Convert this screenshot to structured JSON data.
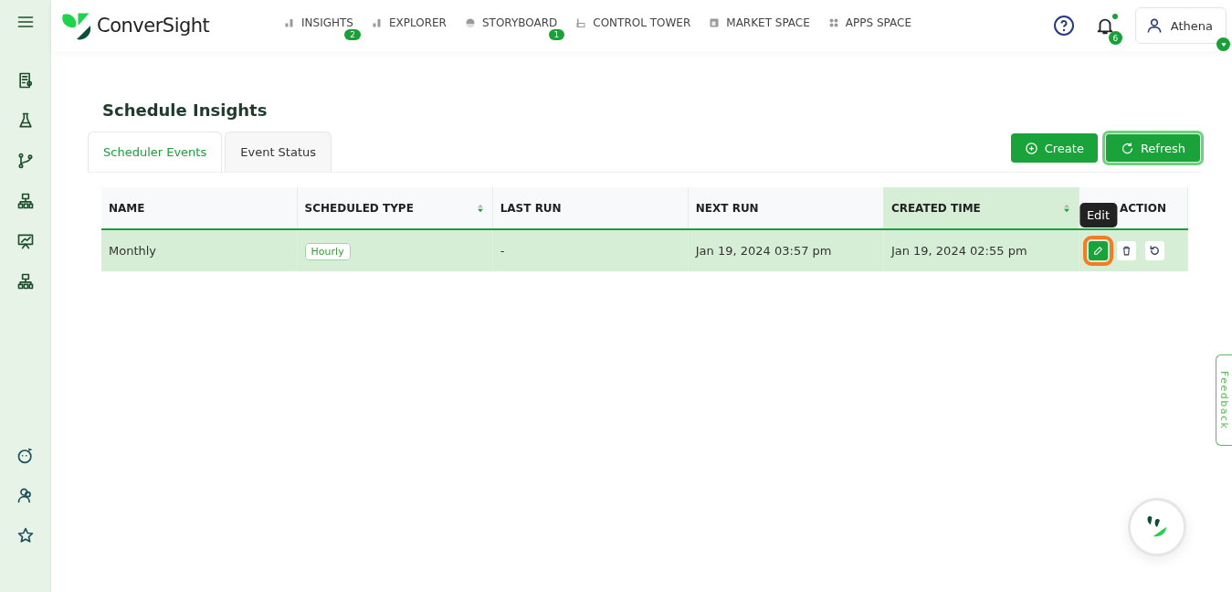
{
  "header": {
    "brand": "ConverSight",
    "nav": [
      {
        "label": "INSIGHTS",
        "kind": "bars",
        "badge": "2"
      },
      {
        "label": "EXPLORER",
        "kind": "bars"
      },
      {
        "label": "STORYBOARD",
        "kind": "gauge",
        "badge": "1"
      },
      {
        "label": "CONTROL TOWER",
        "kind": "tower"
      },
      {
        "label": "MARKET SPACE",
        "kind": "store"
      },
      {
        "label": "APPS SPACE",
        "kind": "dots"
      }
    ],
    "notifications": {
      "count": "6",
      "unread": true
    },
    "user": {
      "name": "Athena"
    }
  },
  "sidebar": {
    "items": [
      {
        "kind": "report"
      },
      {
        "kind": "flask"
      },
      {
        "kind": "branch"
      },
      {
        "kind": "hierarchy"
      },
      {
        "kind": "presentation"
      },
      {
        "kind": "hierarchy"
      }
    ],
    "bottom_items": [
      {
        "kind": "bot"
      },
      {
        "kind": "users"
      },
      {
        "kind": "star"
      }
    ]
  },
  "page": {
    "title": "Schedule Insights",
    "tabs": [
      {
        "label": "Scheduler Events",
        "selected": true
      },
      {
        "label": "Event Status",
        "selected": false
      }
    ],
    "buttons": [
      {
        "label": "Create",
        "kind": "plus",
        "focused": false
      },
      {
        "label": "Refresh",
        "kind": "refresh",
        "focused": true
      }
    ],
    "table": {
      "columns": [
        {
          "label": "NAME",
          "sortable": false,
          "sorted": false
        },
        {
          "label": "SCHEDULED TYPE",
          "sortable": true,
          "sorted": false
        },
        {
          "label": "LAST RUN",
          "sortable": false,
          "sorted": false
        },
        {
          "label": "NEXT RUN",
          "sortable": false,
          "sorted": false
        },
        {
          "label": "CREATED TIME",
          "sortable": true,
          "sorted": true
        },
        {
          "label": "ACTION",
          "sortable": false,
          "sorted": false
        }
      ],
      "rows": [
        {
          "selected": true,
          "name": "Monthly",
          "scheduled_type": "Hourly",
          "last_run": "-",
          "next_run": "Jan 19, 2024 03:57 pm",
          "created_time": "Jan 19, 2024 02:55 pm",
          "actions": [
            {
              "kind": "edit",
              "highlighted": true
            },
            {
              "kind": "delete",
              "highlighted": false
            },
            {
              "kind": "restore",
              "highlighted": false
            }
          ]
        }
      ]
    },
    "tooltip": "Edit"
  },
  "feedback_tab": "Feedback"
}
